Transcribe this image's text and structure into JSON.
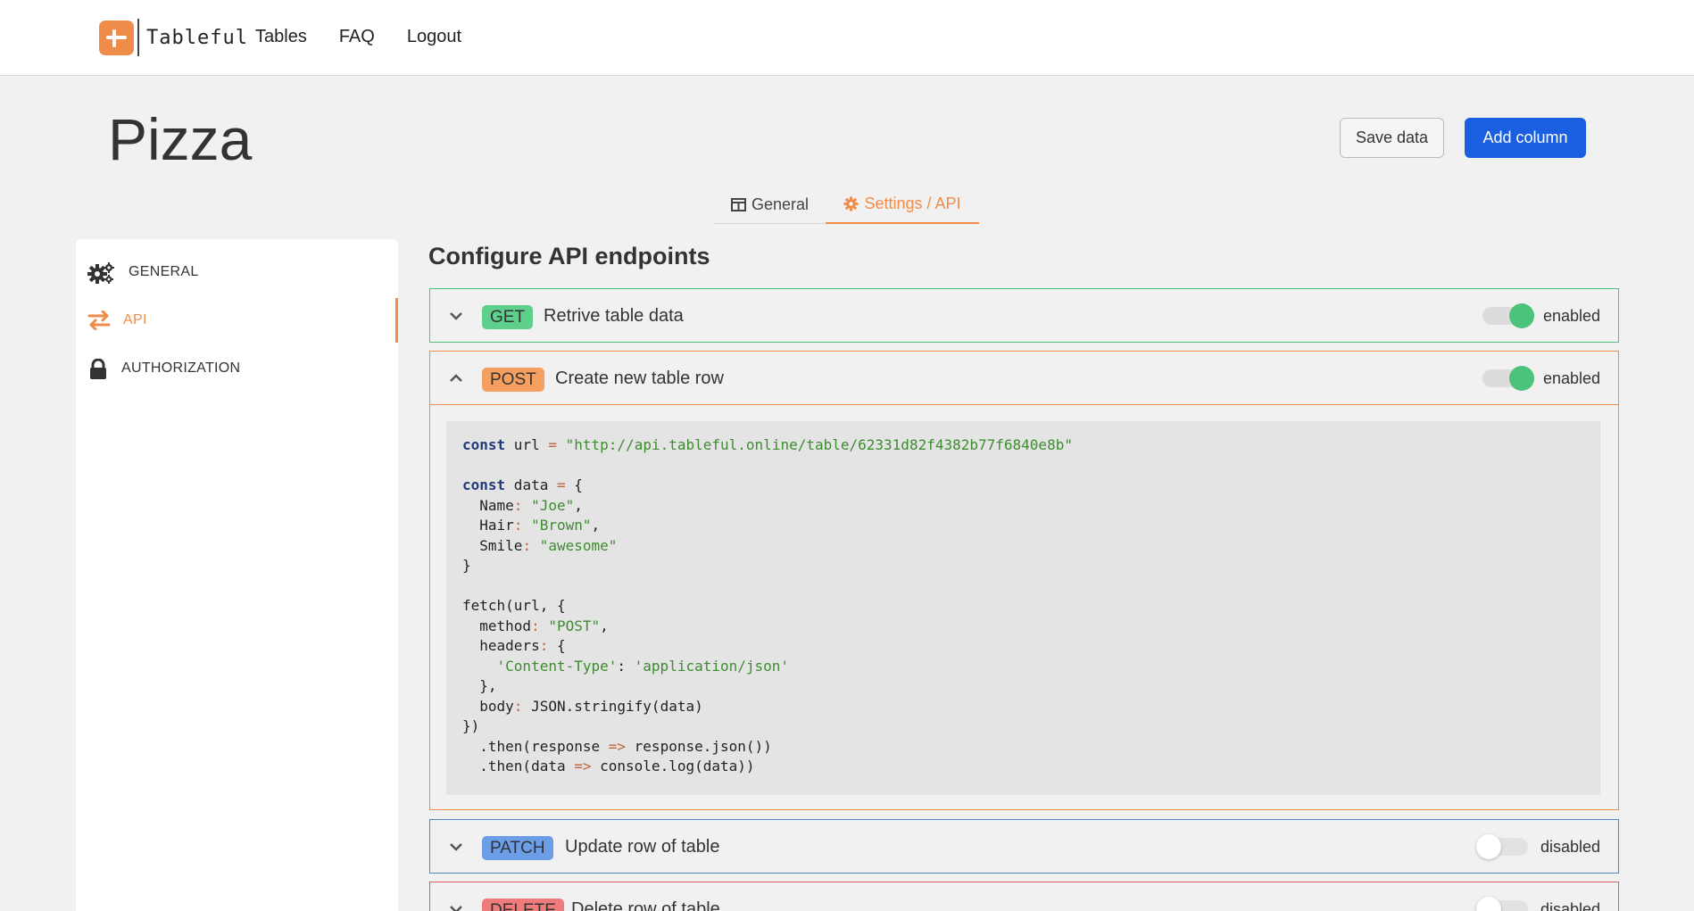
{
  "header": {
    "logo_text": "Tableful",
    "nav": [
      "Tables",
      "FAQ",
      "Logout"
    ]
  },
  "page": {
    "title": "Pizza",
    "save_label": "Save data",
    "add_label": "Add column"
  },
  "tabs": [
    {
      "label": "General",
      "icon": "table-icon",
      "active": false
    },
    {
      "label": "Settings / API",
      "icon": "gear-icon",
      "active": true
    }
  ],
  "sidebar": {
    "items": [
      {
        "label": "GENERAL",
        "icon": "gears-icon",
        "active": false
      },
      {
        "label": "API",
        "icon": "exchange-arrows-icon",
        "active": true
      },
      {
        "label": "AUTHORIZATION",
        "icon": "lock-icon",
        "active": false
      }
    ]
  },
  "main": {
    "section_title": "Configure API endpoints",
    "endpoints": [
      {
        "method": "GET",
        "label": "Retrive table data",
        "status": "enabled",
        "enabled": true,
        "expanded": false,
        "color": "#4cc27a",
        "badge_bg": "#5fd08c"
      },
      {
        "method": "POST",
        "label": "Create new table row",
        "status": "enabled",
        "enabled": true,
        "expanded": true,
        "color": "#f08c4a",
        "badge_bg": "#f5a05f"
      },
      {
        "method": "PATCH",
        "label": "Update row of table",
        "status": "disabled",
        "enabled": false,
        "expanded": false,
        "color": "#4f86c6",
        "badge_bg": "#6c9ee8"
      },
      {
        "method": "DELETE",
        "label": "Delete row of table",
        "status": "disabled",
        "enabled": false,
        "expanded": false,
        "color": "#e05a5a",
        "badge_bg": "#ef7b7b"
      }
    ],
    "code_lines": [
      "const url = \"http://api.tableful.online/table/62331d82f4382b77f6840e8b\"",
      "",
      "const data = {",
      "  Name: \"Joe\",",
      "  Hair: \"Brown\",",
      "  Smile: \"awesome\"",
      "}",
      "",
      "fetch(url, {",
      "  method: \"POST\",",
      "  headers: {",
      "    'Content-Type': 'application/json'",
      "  },",
      "  body: JSON.stringify(data)",
      "})",
      "  .then(response => response.json())",
      "  .then(data => console.log(data))"
    ]
  }
}
